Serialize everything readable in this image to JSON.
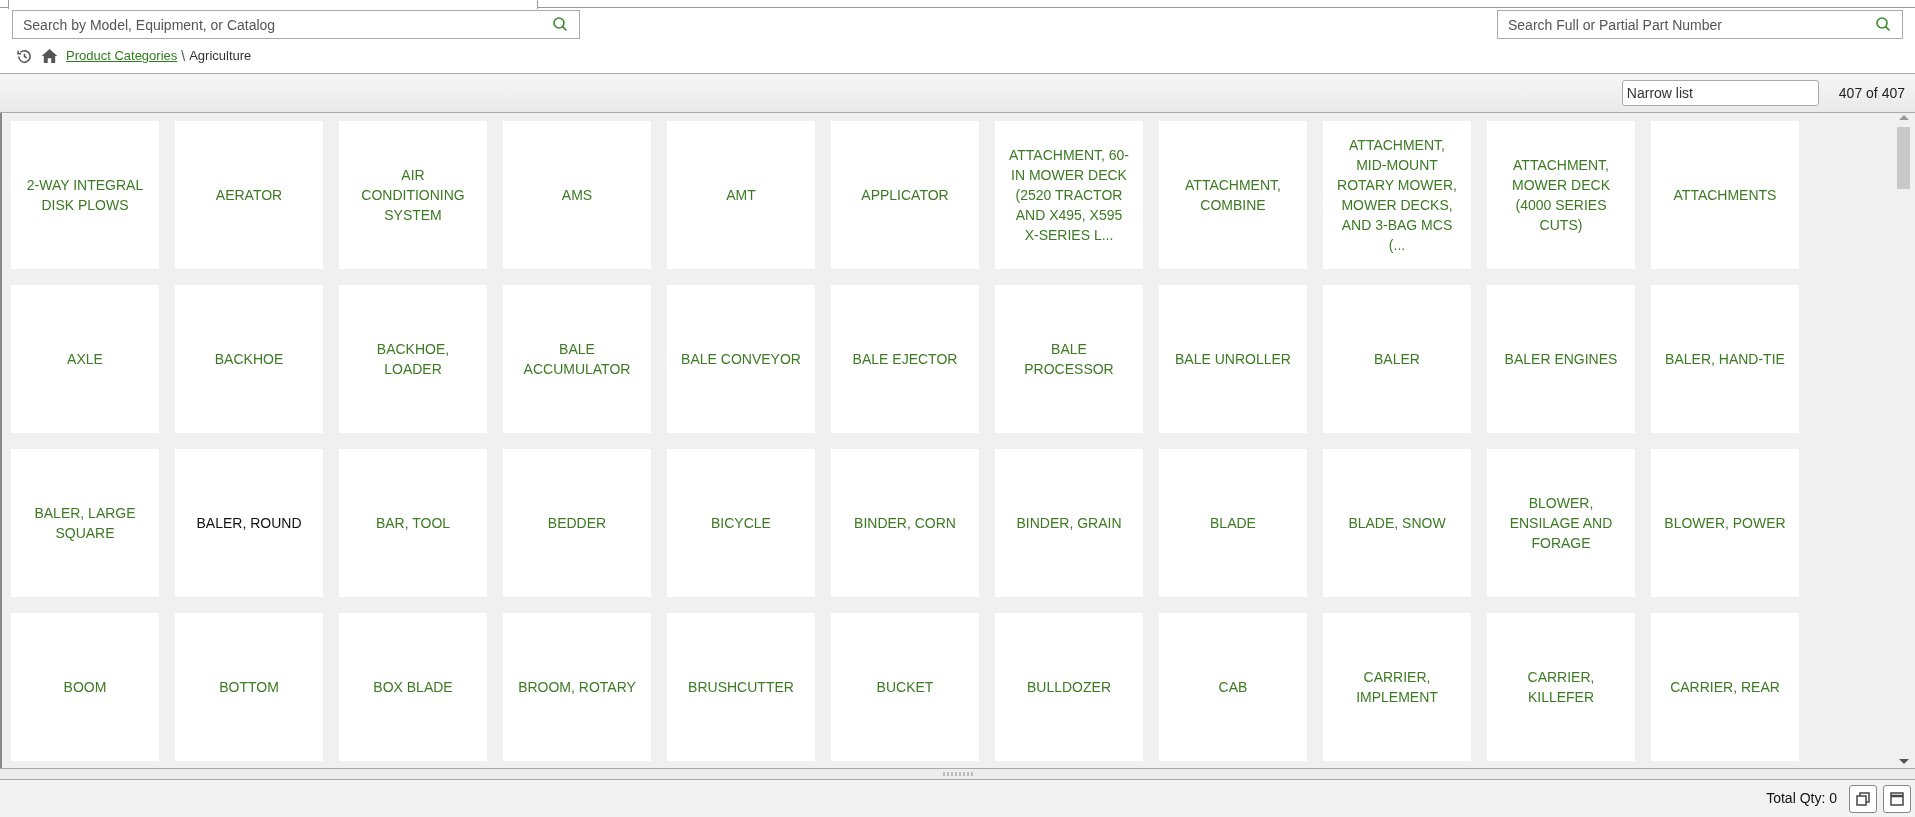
{
  "model_search": {
    "placeholder": "Search by Model, Equipment, or Catalog"
  },
  "part_search": {
    "placeholder": "Search Full or Partial Part Number"
  },
  "breadcrumb": [
    {
      "label": "Product Categories",
      "kind": "link"
    },
    {
      "label": "\\",
      "kind": "separator"
    },
    {
      "label": "Agriculture",
      "kind": "current"
    }
  ],
  "filter": {
    "placeholder": "Narrow list",
    "count": "407 of 407"
  },
  "tiles": [
    {
      "label": "2-WAY INTEGRAL DISK PLOWS",
      "selected": false
    },
    {
      "label": "AERATOR",
      "selected": false
    },
    {
      "label": "AIR CONDITIONING SYSTEM",
      "selected": false
    },
    {
      "label": "AMS",
      "selected": false
    },
    {
      "label": "AMT",
      "selected": false
    },
    {
      "label": "APPLICATOR",
      "selected": false
    },
    {
      "label": "ATTACHMENT, 60-IN MOWER DECK (2520 TRACTOR AND X495, X595 X-SERIES L...",
      "selected": false
    },
    {
      "label": "ATTACHMENT, COMBINE",
      "selected": false
    },
    {
      "label": "ATTACHMENT, MID-MOUNT ROTARY MOWER, MOWER DECKS, AND 3-BAG MCS (...",
      "selected": false
    },
    {
      "label": "ATTACHMENT, MOWER DECK (4000 SERIES CUTS)",
      "selected": false
    },
    {
      "label": "ATTACHMENTS",
      "selected": false
    },
    {
      "label": "AXLE",
      "selected": false
    },
    {
      "label": "BACKHOE",
      "selected": false
    },
    {
      "label": "BACKHOE, LOADER",
      "selected": false
    },
    {
      "label": "BALE ACCUMULATOR",
      "selected": false
    },
    {
      "label": "BALE CONVEYOR",
      "selected": false
    },
    {
      "label": "BALE EJECTOR",
      "selected": false
    },
    {
      "label": "BALE PROCESSOR",
      "selected": false
    },
    {
      "label": "BALE UNROLLER",
      "selected": false
    },
    {
      "label": "BALER",
      "selected": false
    },
    {
      "label": "BALER ENGINES",
      "selected": false
    },
    {
      "label": "BALER, HAND-TIE",
      "selected": false
    },
    {
      "label": "BALER, LARGE SQUARE",
      "selected": false
    },
    {
      "label": "BALER, ROUND",
      "selected": true
    },
    {
      "label": "BAR, TOOL",
      "selected": false
    },
    {
      "label": "BEDDER",
      "selected": false
    },
    {
      "label": "BICYCLE",
      "selected": false
    },
    {
      "label": "BINDER, CORN",
      "selected": false
    },
    {
      "label": "BINDER, GRAIN",
      "selected": false
    },
    {
      "label": "BLADE",
      "selected": false
    },
    {
      "label": "BLADE, SNOW",
      "selected": false
    },
    {
      "label": "BLOWER, ENSILAGE AND FORAGE",
      "selected": false
    },
    {
      "label": "BLOWER, POWER",
      "selected": false
    },
    {
      "label": "BOOM",
      "selected": false
    },
    {
      "label": "BOTTOM",
      "selected": false
    },
    {
      "label": "BOX BLADE",
      "selected": false
    },
    {
      "label": "BROOM, ROTARY",
      "selected": false
    },
    {
      "label": "BRUSHCUTTER",
      "selected": false
    },
    {
      "label": "BUCKET",
      "selected": false
    },
    {
      "label": "BULLDOZER",
      "selected": false
    },
    {
      "label": "CAB",
      "selected": false
    },
    {
      "label": "CARRIER, IMPLEMENT",
      "selected": false
    },
    {
      "label": "CARRIER, KILLEFER",
      "selected": false
    },
    {
      "label": "CARRIER, REAR",
      "selected": false
    }
  ],
  "status_bar": {
    "total_qty": "Total Qty: 0"
  }
}
